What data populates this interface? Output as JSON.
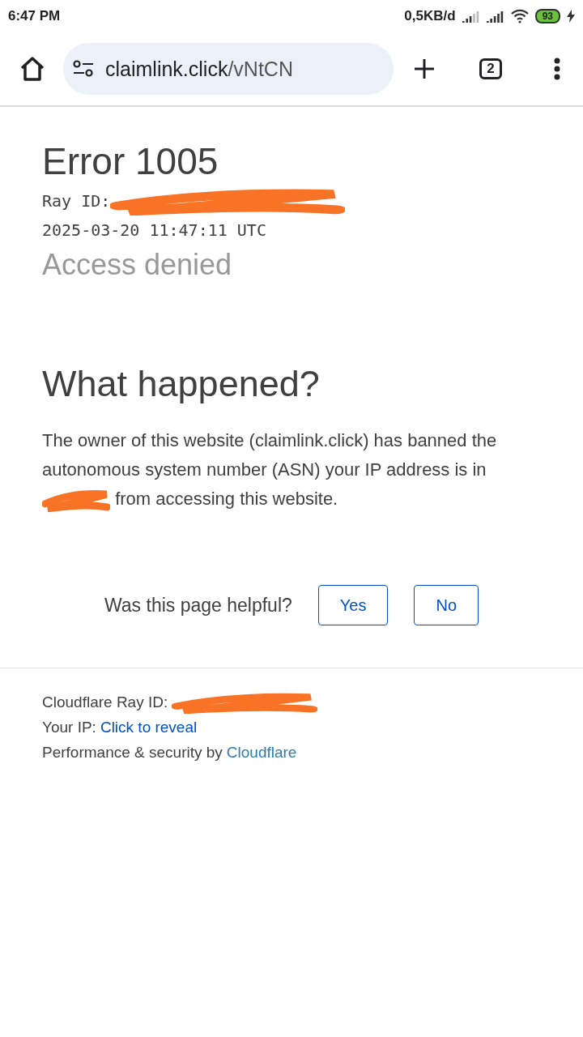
{
  "status_bar": {
    "time": "6:47 PM",
    "data_rate": "0,5KB/d",
    "battery": "93",
    "charging": true
  },
  "browser": {
    "url_host": "claimlink.click",
    "url_path": "/vNtCN",
    "tab_count": "2"
  },
  "error": {
    "title": "Error 1005",
    "ray_label": "Ray ID:",
    "timestamp": "2025-03-20 11:47:11 UTC",
    "subtitle": "Access denied"
  },
  "what_happened": {
    "heading": "What happened?",
    "text_before": "The owner of this website (claimlink.click) has banned the autonomous system number (ASN) your IP address is in",
    "text_after": "from accessing this website."
  },
  "feedback": {
    "question": "Was this page helpful?",
    "buttons": [
      "Yes",
      "No"
    ]
  },
  "footer": {
    "ray_label": "Cloudflare Ray ID:",
    "ip_label": "Your IP:",
    "ip_link": "Click to reveal",
    "perf_label": "Performance & security by",
    "perf_link": "Cloudflare"
  }
}
